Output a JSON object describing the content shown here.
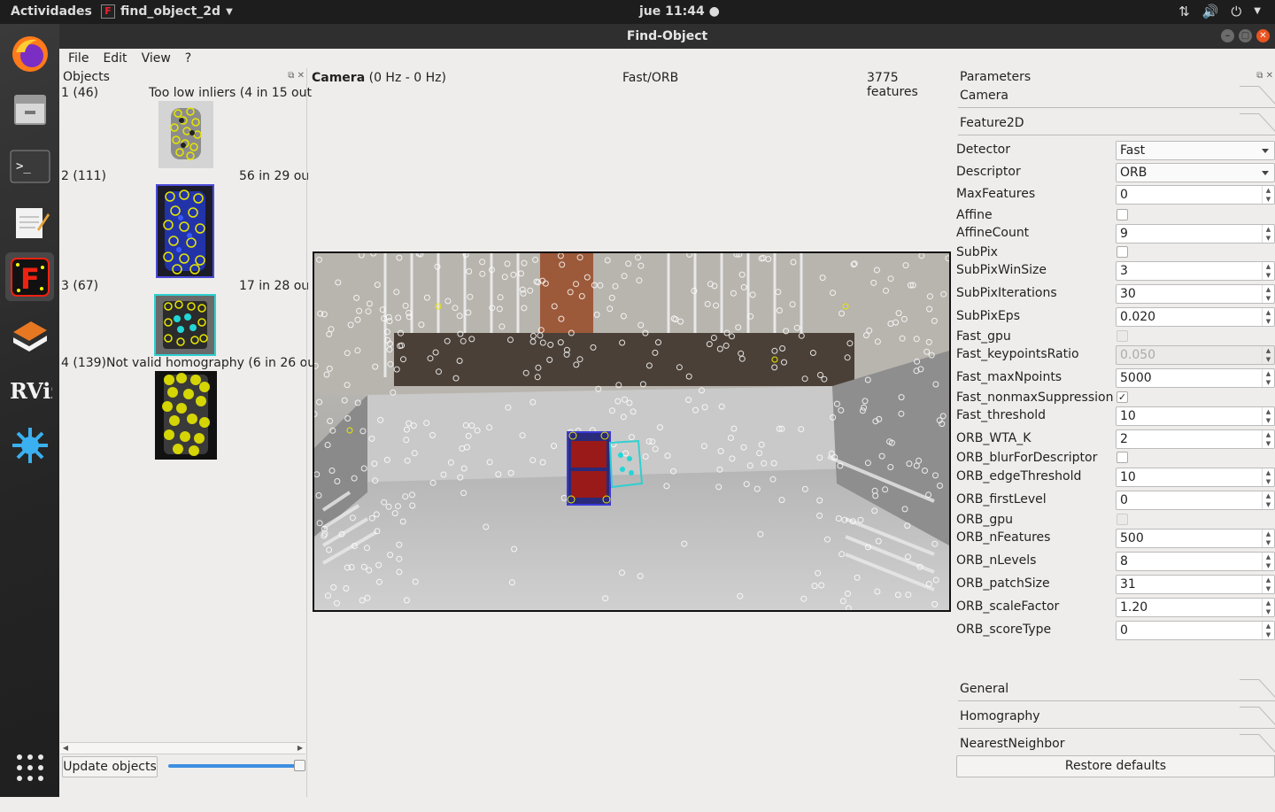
{
  "topbar": {
    "activities": "Actividades",
    "app_name": "find_object_2d",
    "clock": "jue 11:44"
  },
  "window": {
    "title": "Find-Object"
  },
  "menu": {
    "file": "File",
    "edit": "Edit",
    "view": "View",
    "help": "?"
  },
  "objects_panel": {
    "title": "Objects",
    "items": [
      {
        "id": "1 (46)",
        "status": "Too low inliers (4 in 15 out"
      },
      {
        "id": "2 (111)",
        "status": "56 in 29 ou"
      },
      {
        "id": "3 (67)",
        "status": "17 in 28 ou"
      },
      {
        "id": "4 (139)",
        "status": "Not valid homography (6 in 26 out"
      }
    ],
    "update_button": "Update objects",
    "slider_value": 1.0
  },
  "camera_panel": {
    "title": "Camera",
    "rate": "(0 Hz - 0 Hz)",
    "method": "Fast/ORB",
    "features": "3775 features"
  },
  "parameters_panel": {
    "title": "Parameters",
    "sections_top": [
      "Camera",
      "Feature2D"
    ],
    "sections_bottom": [
      "General",
      "Homography",
      "NearestNeighbor"
    ],
    "rows": [
      {
        "label": "Detector",
        "type": "combo",
        "value": "Fast"
      },
      {
        "label": "Descriptor",
        "type": "combo",
        "value": "ORB"
      },
      {
        "label": "MaxFeatures",
        "type": "spin",
        "value": "0"
      },
      {
        "label": "Affine",
        "type": "check",
        "checked": false
      },
      {
        "label": "AffineCount",
        "type": "spin",
        "value": "9"
      },
      {
        "label": "SubPix",
        "type": "check",
        "checked": false
      },
      {
        "label": "SubPixWinSize",
        "type": "spin",
        "value": "3"
      },
      {
        "label": "SubPixIterations",
        "type": "spin",
        "value": "30"
      },
      {
        "label": "SubPixEps",
        "type": "spin",
        "value": "0.020"
      },
      {
        "label": "Fast_gpu",
        "type": "check",
        "checked": false,
        "disabled": true
      },
      {
        "label": "Fast_keypointsRatio",
        "type": "spin",
        "value": "0.050",
        "disabled": true
      },
      {
        "label": "Fast_maxNpoints",
        "type": "spin",
        "value": "5000"
      },
      {
        "label": "Fast_nonmaxSuppression",
        "type": "check",
        "checked": true
      },
      {
        "label": "Fast_threshold",
        "type": "spin",
        "value": "10"
      },
      {
        "label": "ORB_WTA_K",
        "type": "spin",
        "value": "2"
      },
      {
        "label": "ORB_blurForDescriptor",
        "type": "check",
        "checked": false
      },
      {
        "label": "ORB_edgeThreshold",
        "type": "spin",
        "value": "10"
      },
      {
        "label": "ORB_firstLevel",
        "type": "spin",
        "value": "0"
      },
      {
        "label": "ORB_gpu",
        "type": "check",
        "checked": false,
        "disabled": true
      },
      {
        "label": "ORB_nFeatures",
        "type": "spin",
        "value": "500"
      },
      {
        "label": "ORB_nLevels",
        "type": "spin",
        "value": "8"
      },
      {
        "label": "ORB_patchSize",
        "type": "spin",
        "value": "31"
      },
      {
        "label": "ORB_scaleFactor",
        "type": "spin",
        "value": "1.20"
      },
      {
        "label": "ORB_scoreType",
        "type": "spin",
        "value": "0"
      }
    ],
    "restore_button": "Restore defaults"
  },
  "dock_apps": [
    "firefox-icon",
    "files-icon",
    "terminal-icon",
    "text-editor-icon",
    "find-object-icon",
    "layers-icon",
    "rviz-icon",
    "splash-icon"
  ]
}
